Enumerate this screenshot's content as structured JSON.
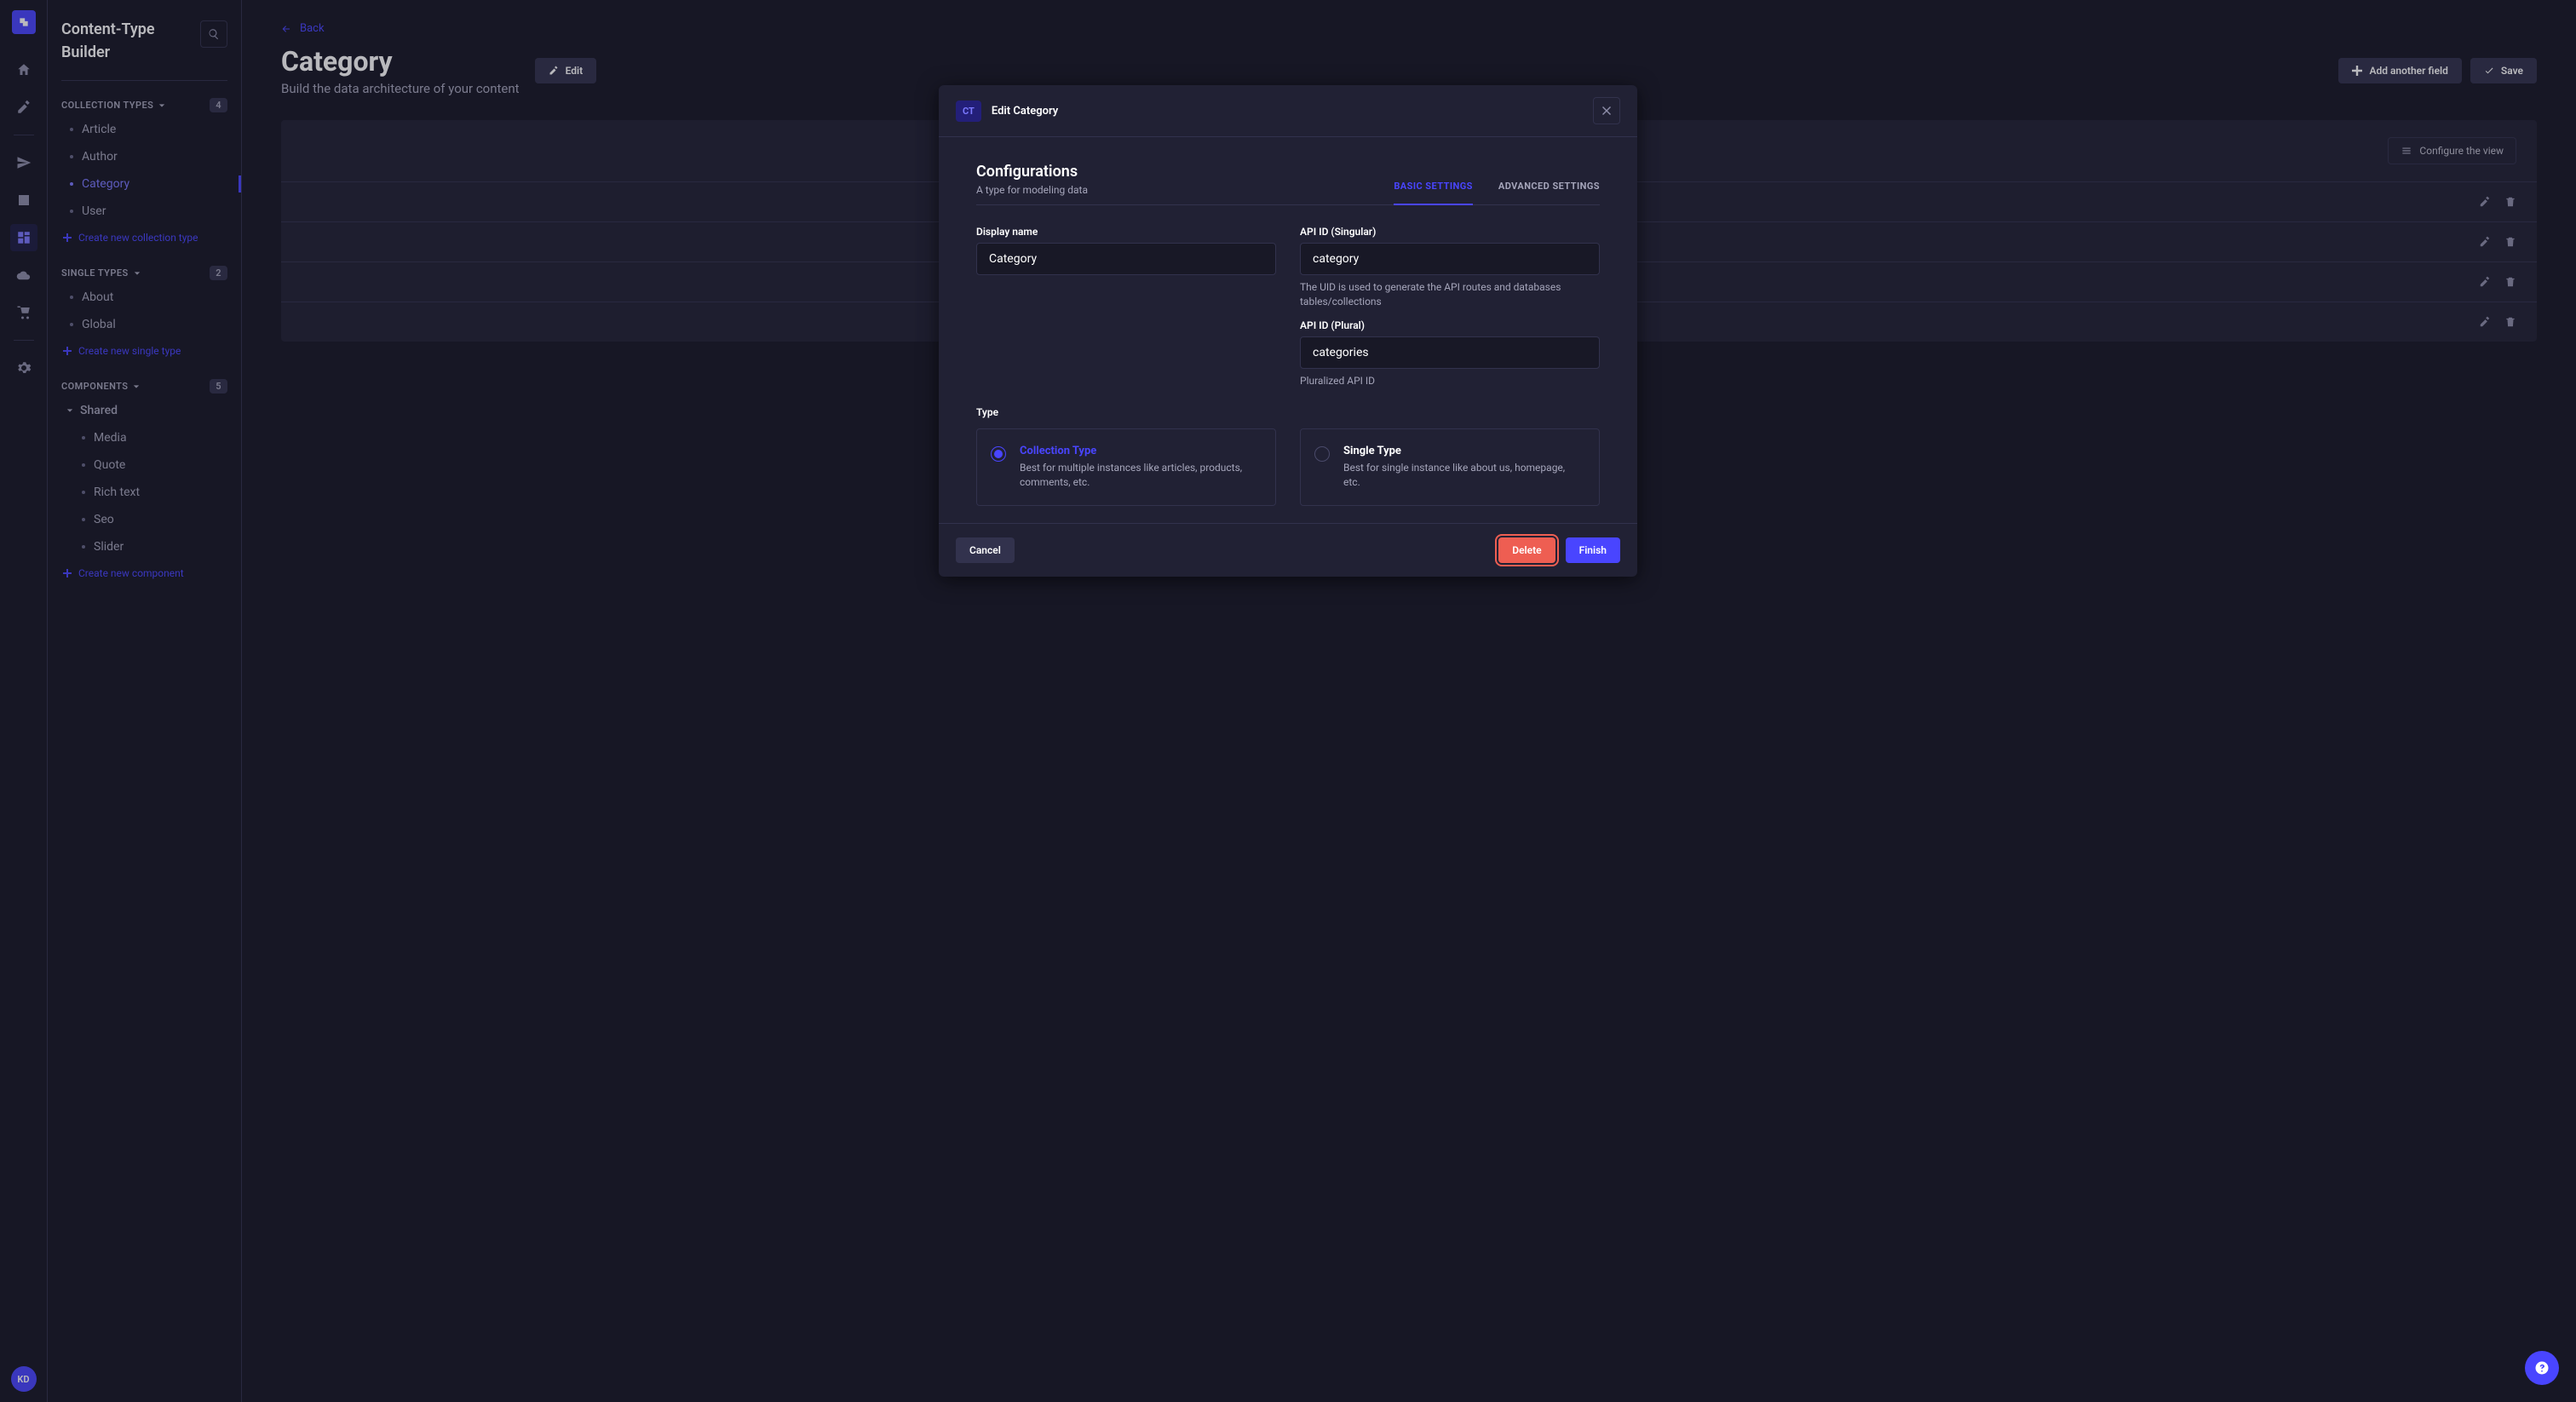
{
  "rail": {
    "avatar_initials": "KD"
  },
  "sidebar": {
    "title_line1": "Content-Type",
    "title_line2": "Builder",
    "groups": [
      {
        "label": "COLLECTION TYPES",
        "count": "4",
        "items": [
          {
            "label": "Article",
            "active": false
          },
          {
            "label": "Author",
            "active": false
          },
          {
            "label": "Category",
            "active": true
          },
          {
            "label": "User",
            "active": false
          }
        ],
        "create_label": "Create new collection type"
      },
      {
        "label": "SINGLE TYPES",
        "count": "2",
        "items": [
          {
            "label": "About",
            "active": false
          },
          {
            "label": "Global",
            "active": false
          }
        ],
        "create_label": "Create new single type"
      },
      {
        "label": "COMPONENTS",
        "count": "5",
        "folder_label": "Shared",
        "items": [
          {
            "label": "Media"
          },
          {
            "label": "Quote"
          },
          {
            "label": "Rich text"
          },
          {
            "label": "Seo"
          },
          {
            "label": "Slider"
          }
        ],
        "create_label": "Create new component"
      }
    ]
  },
  "page": {
    "back_label": "Back",
    "title": "Category",
    "subtitle": "Build the data architecture of your content",
    "edit_label": "Edit",
    "add_field_label": "Add another field",
    "save_label": "Save",
    "configure_label": "Configure the view"
  },
  "modal": {
    "pill": "CT",
    "title": "Edit Category",
    "config_title": "Configurations",
    "config_subtitle": "A type for modeling data",
    "tab_basic": "BASIC SETTINGS",
    "tab_advanced": "ADVANCED SETTINGS",
    "display_name_label": "Display name",
    "display_name_value": "Category",
    "api_singular_label": "API ID (Singular)",
    "api_singular_value": "category",
    "api_singular_help": "The UID is used to generate the API routes and databases tables/collections",
    "api_plural_label": "API ID (Plural)",
    "api_plural_value": "categories",
    "api_plural_help": "Pluralized API ID",
    "type_label": "Type",
    "collection_type_title": "Collection Type",
    "collection_type_desc": "Best for multiple instances like articles, products, comments, etc.",
    "single_type_title": "Single Type",
    "single_type_desc": "Best for single instance like about us, homepage, etc.",
    "cancel_label": "Cancel",
    "delete_label": "Delete",
    "finish_label": "Finish"
  }
}
